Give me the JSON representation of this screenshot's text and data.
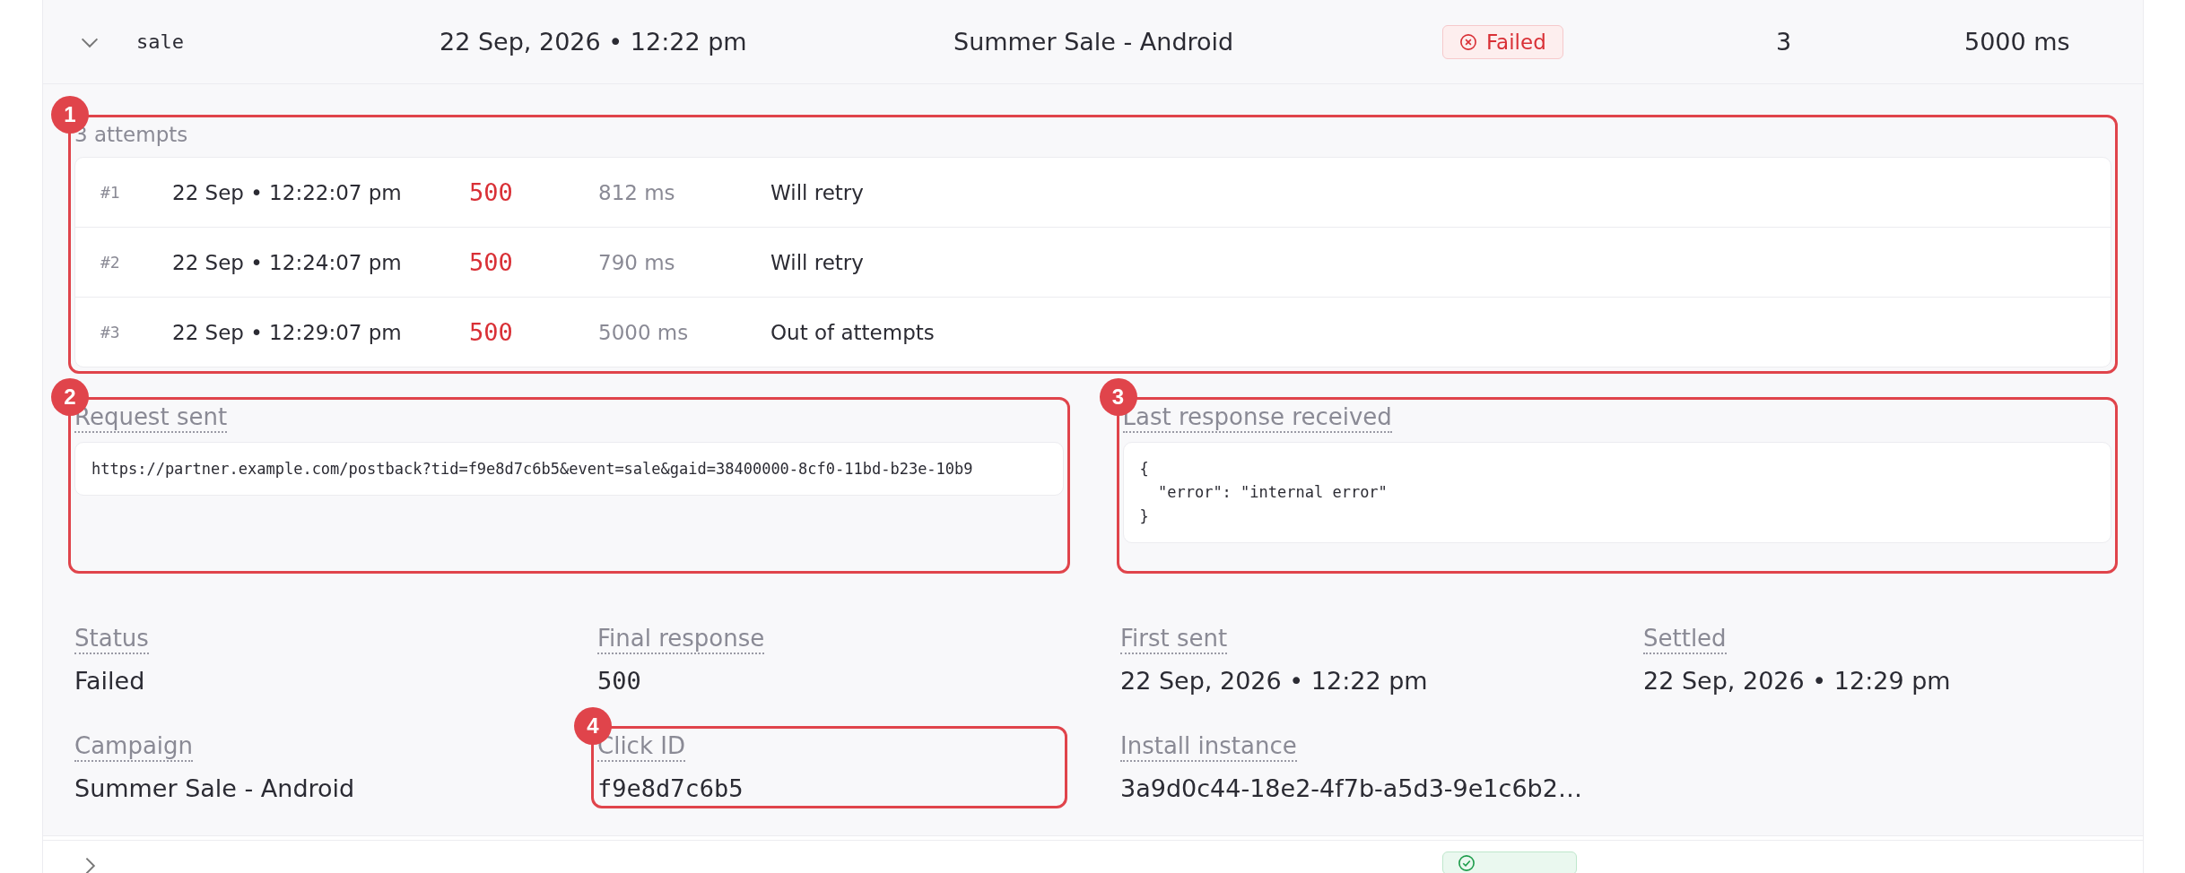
{
  "expanded_row": {
    "expanded": true,
    "event": "sale",
    "time": "22 Sep, 2026 • 12:22 pm",
    "campaign": "Summer Sale - Android",
    "status": {
      "label": "Failed",
      "kind": "failed"
    },
    "attempts": "3",
    "duration": "5000 ms"
  },
  "attempts_panel": {
    "callout": "1",
    "title": "3 attempts",
    "attempts": [
      {
        "number": "#1",
        "time": "22 Sep • 12:22:07 pm",
        "code": "500",
        "duration": "812 ms",
        "result": "Will retry"
      },
      {
        "number": "#2",
        "time": "22 Sep • 12:24:07 pm",
        "code": "500",
        "duration": "790 ms",
        "result": "Will retry"
      },
      {
        "number": "#3",
        "time": "22 Sep • 12:29:07 pm",
        "code": "500",
        "duration": "5000 ms",
        "result": "Out of attempts"
      }
    ]
  },
  "request_panel": {
    "callout": "2",
    "title": "Request sent",
    "body": "https://partner.example.com/postback?tid=f9e8d7c6b5&event=sale&gaid=38400000-8cf0-11bd-b23e-10b9"
  },
  "response_panel": {
    "callout": "3",
    "title": "Last response received",
    "body": "{\n  \"error\": \"internal error\"\n}"
  },
  "details": [
    {
      "label": "Status",
      "value": "Failed",
      "mono": false
    },
    {
      "label": "Final response",
      "value": "500",
      "mono": true
    },
    {
      "label": "First sent",
      "value": "22 Sep, 2026 • 12:22 pm",
      "mono": false
    },
    {
      "label": "Settled",
      "value": "22 Sep, 2026 • 12:29 pm",
      "mono": false
    },
    {
      "label": "Campaign",
      "value": "Summer Sale - Android",
      "mono": false
    },
    {
      "label": "Click ID",
      "value": "f9e8d7c6b5",
      "mono": true,
      "callout": "4"
    },
    {
      "label": "Install instance",
      "value": "3a9d0c44-18e2-4f7b-a5d3-9e1c6b2…",
      "mono": false
    }
  ],
  "next_row": {
    "expanded": false,
    "status": {
      "kind": "delivered"
    }
  }
}
